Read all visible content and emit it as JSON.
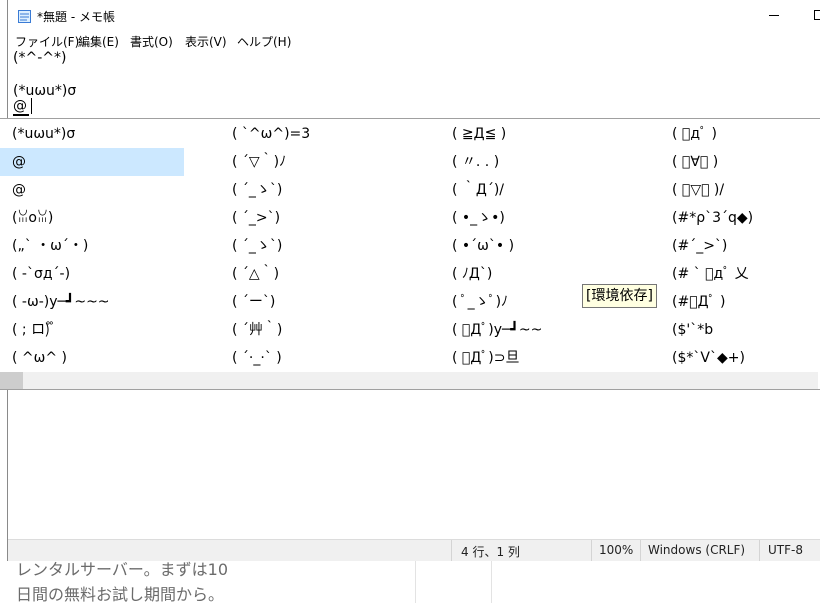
{
  "background": {
    "lines": [
      "レンタルサーバー。まずは10",
      "日間の無料お試し期間から。"
    ]
  },
  "window": {
    "title": "*無題 - メモ帳",
    "menu": [
      "ファイル(F)",
      "編集(E)",
      "書式(O)",
      "表示(V)",
      "ヘルプ(H)"
    ],
    "editor_lines": [
      "(*^-^*)",
      "",
      "(*uωu*)σ",
      "@"
    ]
  },
  "candidates": {
    "columns": [
      [
        "(*uωu*)σ",
        "@",
        "@",
        "(ꈍoꈍ)",
        "(„` ・ω´・)",
        "( -`σд´-)",
        "( -ω-)y─┛~~~",
        "( ; ロ)゚ ゚",
        "( ^ω^ )"
      ],
      [
        "( `^ω^)=3",
        "( ´▽｀)ﾉ",
        "( ´_ゝ`)",
        "( ´_>`)",
        "( ´_ゝ`)",
        "( ´△｀)",
        "( ´ー`)",
        "( ´艸｀)",
        "( ´·_·` )"
      ],
      [
        "( ≧Д≦ )",
        "( 〃. . )",
        "( ｀Д´)/",
        "( •_ゝ•)",
        "( •´ω`• )",
        "( ﾉД`)",
        "( ﾟ_ゝﾟ)ﾉ",
        "( ﾟДﾟ)y─┛~~",
        "( ﾟДﾟ)⊃旦"
      ],
      [
        "( ﾟдﾟ )",
        "( ﾟ∀ﾟ )",
        "( ﾟ▽ﾟ )/",
        "(#*ρ`3´q◆)",
        "(#´_>`)",
        "(# ` ﾟдﾟ 乂",
        "(#ﾟДﾟ )",
        "($'`*b",
        "($*`V`◆+)"
      ]
    ],
    "selected_index": 1,
    "tooltip": "[環境依存]"
  },
  "status": {
    "position": "4 行、1 列",
    "zoom": "100%",
    "line_ending": "Windows (CRLF)",
    "encoding": "UTF-8"
  }
}
